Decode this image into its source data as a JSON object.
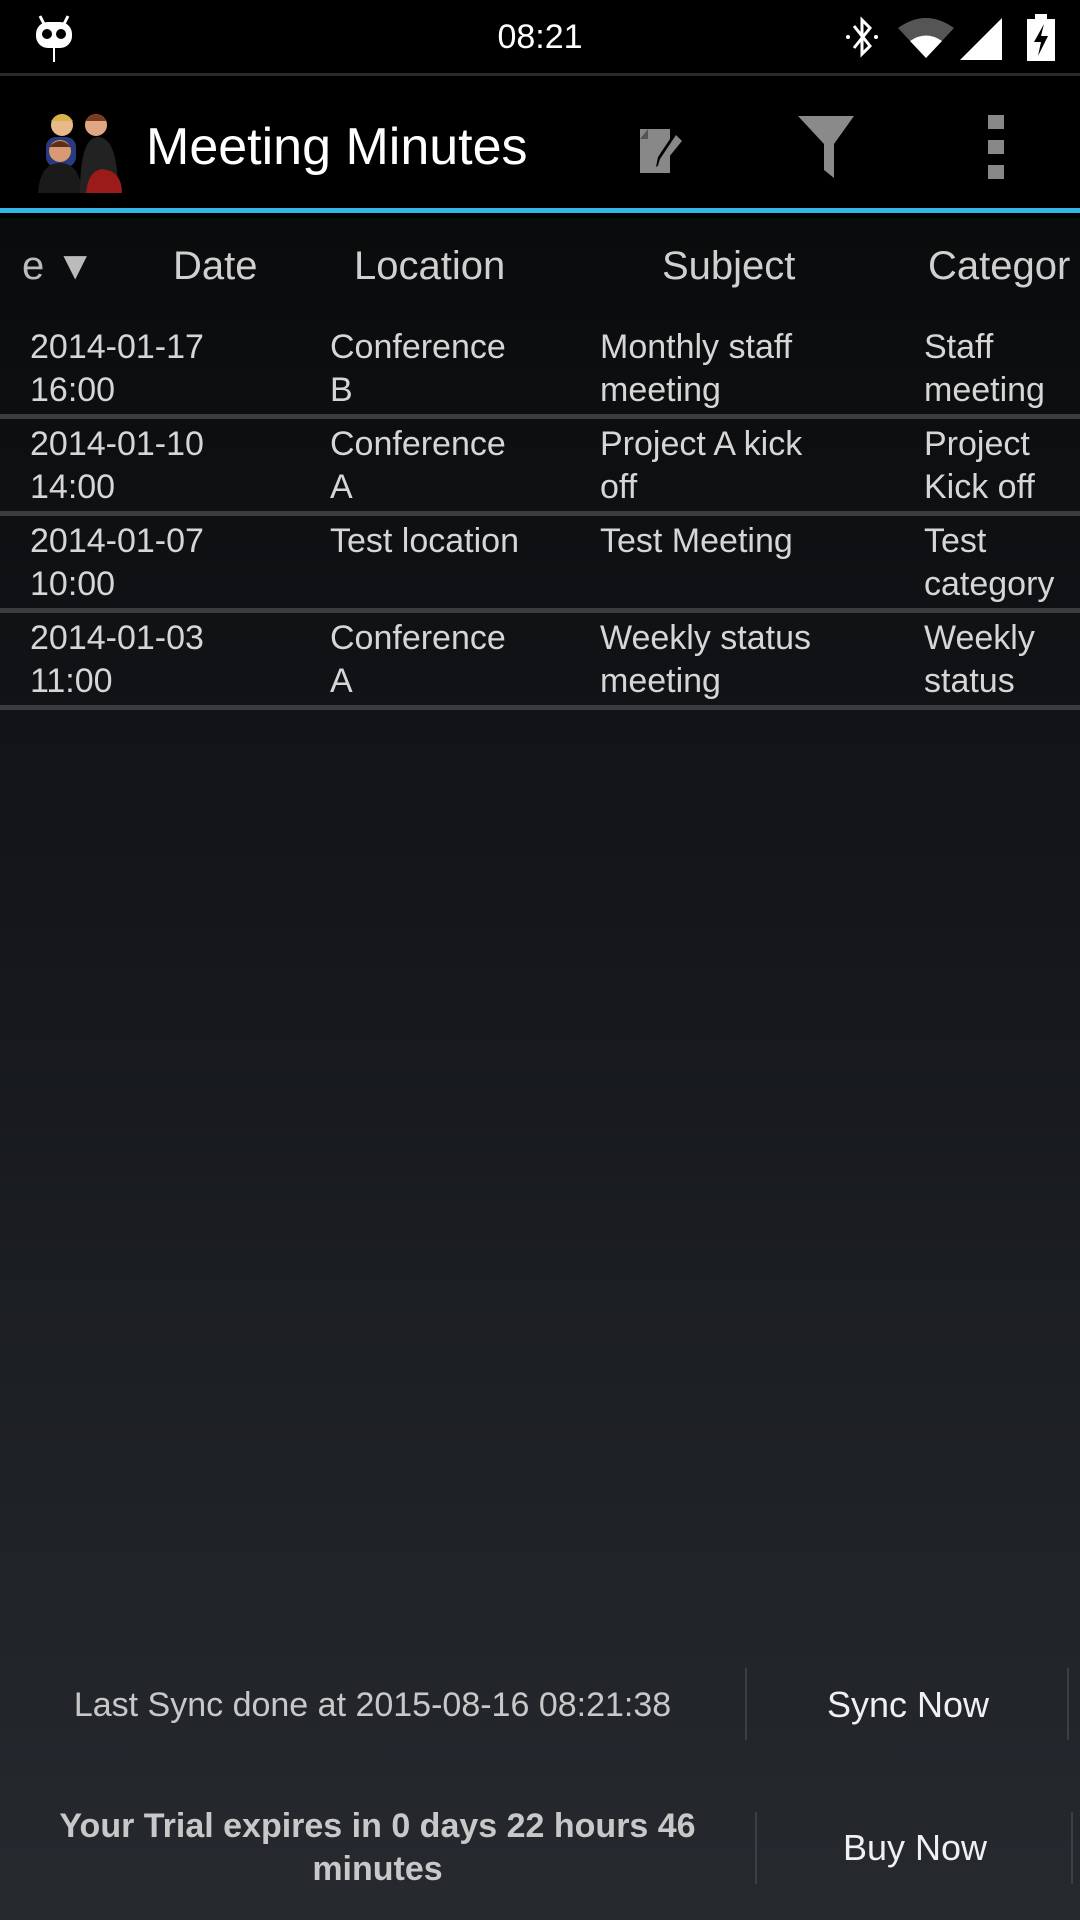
{
  "status_bar": {
    "time": "08:21",
    "icons": [
      "cyanogenmod-icon",
      "bluetooth-icon",
      "wifi-icon",
      "signal-icon",
      "battery-charging-icon"
    ]
  },
  "action_bar": {
    "title": "Meeting Minutes",
    "icons": [
      "app-logo-icon",
      "edit-icon",
      "filter-icon",
      "overflow-menu-icon"
    ]
  },
  "accent_color": "#33b5e5",
  "table": {
    "sort_indicator": "e ▼",
    "columns": [
      "Date",
      "Location",
      "Subject",
      "Categor"
    ],
    "rows": [
      {
        "date": "2014-01-17\n16:00",
        "location": "Conference\nB",
        "subject": "Monthly staff\nmeeting",
        "category": "Staff\nmeeting"
      },
      {
        "date": "2014-01-10\n14:00",
        "location": "Conference\nA",
        "subject": "Project A kick\noff",
        "category": "Project\nKick off"
      },
      {
        "date": "2014-01-07\n10:00",
        "location": "Test location",
        "subject": "Test Meeting",
        "category": "Test\ncategory"
      },
      {
        "date": "2014-01-03\n11:00",
        "location": "Conference\nA",
        "subject": "Weekly status\nmeeting",
        "category": "Weekly\nstatus"
      }
    ]
  },
  "footer": {
    "sync_text": "Last Sync done at 2015-08-16 08:21:38",
    "sync_button": "Sync Now",
    "trial_text": "Your Trial expires in 0 days 22 hours 46 minutes",
    "buy_button": "Buy Now"
  }
}
